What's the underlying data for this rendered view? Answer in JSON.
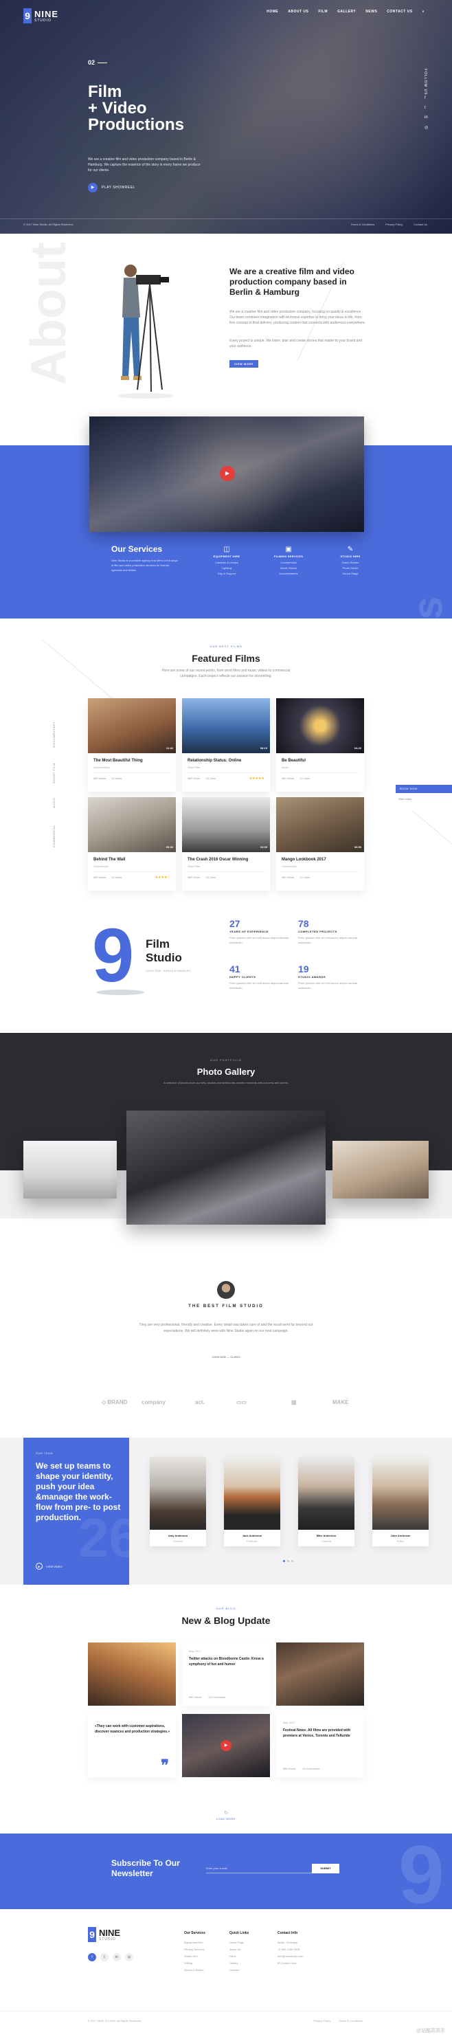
{
  "brand": {
    "logo_mark": "9",
    "name": "NINE",
    "sub": "STUDIO"
  },
  "nav": [
    "HOME",
    "ABOUT US",
    "FILM",
    "GALLERY",
    "NEWS",
    "CONTACT US",
    "⌕"
  ],
  "hero": {
    "number": "02",
    "title": "Film\n+ Video\nProductions",
    "description": "We are a creative film and video production company based in Berlin & Hamburg. We capture the essence of the story in every frame we produce for our clients.",
    "play_label": "PLAY SHOWREEL",
    "follow": "FOLLOW US",
    "social": [
      "f",
      "t",
      "in",
      "◎"
    ],
    "copyright": "© 2017 Nine Studio. All Rights Reserved.",
    "links": [
      "Terms & Conditions",
      "Privacy Policy",
      "Contact Us"
    ]
  },
  "about": {
    "bg_word": "About",
    "title": "We are a creative film and video production company based in Berlin & Hamburg",
    "p1": "We are a creative film and video production company, focusing on quality & excellence. Our team combines imagination with technical expertise to bring your ideas to life, from first concept to final delivery, producing content that connects with audiences everywhere.",
    "p2": "Every project is unique. We listen, plan and create stories that matter to your brand and your audience.",
    "button": "VIEW MORE"
  },
  "services": {
    "bg_word": "Services",
    "title": "Our Services",
    "description": "Nine Studio is a creative agency that offers a full range of film and video production services for brands, agencies and artists.",
    "items": [
      {
        "icon": "camera-icon",
        "title": "EQUIPMENT HIRE",
        "lines": [
          "Cameras & Lenses",
          "Lighting",
          "Grip & Support"
        ]
      },
      {
        "icon": "film-icon",
        "title": "FILMING SERVICES",
        "lines": [
          "Commercials",
          "Music Videos",
          "Documentaries"
        ]
      },
      {
        "icon": "edit-icon",
        "title": "STUDIO HIRE",
        "lines": [
          "Green Screen",
          "Photo Studio",
          "Sound Stage"
        ]
      }
    ]
  },
  "films": {
    "kicker": "OUR BEST FILMS",
    "title": "Featured Films",
    "description": "Here are some of our recent works, from short films and music videos to commercial campaigns. Each project reflects our passion for storytelling.",
    "side_nav": [
      "DOCUMENTARY",
      "SHORT FILM",
      "MUSIC",
      "COMMERCIAL"
    ],
    "book_button": "BOOK NOW",
    "book_sub": "Start today",
    "cards": [
      {
        "title": "The Most Beautiful Thing",
        "category": "Documentary",
        "duration": "12:42",
        "views": "980 Views",
        "likes": "24 Likes",
        "stars": ""
      },
      {
        "title": "Relationship Status: Online",
        "category": "Short Film",
        "duration": "08:15",
        "views": "980 Views",
        "likes": "24 Likes",
        "stars": "★★★★★"
      },
      {
        "title": "Be Beautiful",
        "category": "Music",
        "duration": "04:20",
        "views": "980 Views",
        "likes": "24 Likes",
        "stars": ""
      },
      {
        "title": "Behind The Wall",
        "category": "Commercial",
        "duration": "03:30",
        "views": "980 Views",
        "likes": "24 Likes",
        "stars": "★★★★☆"
      },
      {
        "title": "The Crash 2016 Oscar Winning",
        "category": "Short Film",
        "duration": "10:05",
        "views": "980 Views",
        "likes": "24 Likes",
        "stars": ""
      },
      {
        "title": "Mango Lookbook 2017",
        "category": "Commercial",
        "duration": "02:50",
        "views": "980 Views",
        "likes": "24 Likes",
        "stars": ""
      }
    ]
  },
  "stats": {
    "big_number": "9",
    "title": "Film\nStudio",
    "sub": "SINCE 2008 · BERLIN & HAMBURG",
    "items": [
      {
        "n": "27",
        "l": "YEARS OF EXPERIENCE",
        "d": "Proin gravida nibh vel velit auctor aliquet aenean sollicitudin."
      },
      {
        "n": "78",
        "l": "COMPLETED PROJECTS",
        "d": "Proin gravida nibh vel velit auctor aliquet aenean sollicitudin."
      },
      {
        "n": "41",
        "l": "HAPPY CLIENTS",
        "d": "Proin gravida nibh vel velit auctor aliquet aenean sollicitudin."
      },
      {
        "n": "19",
        "l": "STUDIO AWARDS",
        "d": "Proin gravida nibh vel velit auctor aliquet aenean sollicitudin."
      }
    ]
  },
  "gallery": {
    "kicker": "OUR PORTFOLIO",
    "title": "Photo Gallery",
    "description": "A selection of photos from our sets, studios and behind-the-scenes moments with our crew and clients."
  },
  "testimonial": {
    "kicker": "THE BEST FILM STUDIO",
    "text": "They are very professional, friendly and creative. Every detail was taken care of and the result went far beyond our expectations. We will definitely work with Nine Studio again on our next campaign.",
    "name": "JOHN DOE — CLIENT"
  },
  "partners": [
    "◇ BRAND",
    "company",
    "act.",
    "▭▭",
    "▥",
    "MAKE"
  ],
  "team": {
    "kicker": "OUR TEAM",
    "title": "We set up teams to shape your identity, push your idea &manage the work-flow from pre- to post production.",
    "video": "VIEW VIDEO",
    "big": "26",
    "members": [
      {
        "name": "Amy Anderson",
        "role": "Director"
      },
      {
        "name": "Jack Anderson",
        "role": "Producer"
      },
      {
        "name": "Mike Anderson",
        "role": "Camera"
      },
      {
        "name": "John Anderson",
        "role": "Editor"
      }
    ]
  },
  "blog": {
    "kicker": "OUR BLOG",
    "title": "New & Blog Update",
    "posts": [
      {
        "date": "May 2017",
        "title": "Twitter attacks on Bloodborne Castle: Know a symphony of fun and humor",
        "views": "980 Views",
        "comments": "24 Comments"
      },
      {
        "date": "May 2017",
        "title": "Festival News: All films are provided with premiere at Venice, Toronto and Telluride",
        "views": "980 Views",
        "comments": "24 Comments"
      },
      {
        "date": "May 2017",
        "title": "«They can work with customer aspirations, discover nuances and production strategies.»",
        "views": "",
        "comments": "",
        "quote": "❞"
      }
    ],
    "load_more": "LOAD MORE"
  },
  "subscribe": {
    "title": "Subscribe To Our Newsletter",
    "placeholder": "Enter your e-mail",
    "button": "SUBMIT",
    "big": "9"
  },
  "footer": {
    "columns": [
      {
        "h": "Our Services",
        "items": [
          "Equipment Hire",
          "Filming Services",
          "Studio Hire",
          "Editing",
          "Sound & Motion"
        ]
      },
      {
        "h": "Quick Links",
        "items": [
          "Home Page",
          "About Us",
          "Films",
          "Gallery",
          "Contact"
        ]
      },
      {
        "h": "Contact Info",
        "items": [
          "Berlin, Germany",
          "+1 800 1234 5678",
          "info@ninestudio.com",
          "✉ Contact Now"
        ]
      }
    ],
    "social": [
      "f",
      "t",
      "in",
      "◎"
    ],
    "copyright": "© 2017 NINE STUDIO. All Rights Reserved.",
    "links": [
      "Privacy Policy",
      "Terms & Conditions"
    ]
  },
  "watermark": "@站酷高高手",
  "colors": {
    "accent": "#4a6bdc",
    "dark": "#2b2c31"
  }
}
